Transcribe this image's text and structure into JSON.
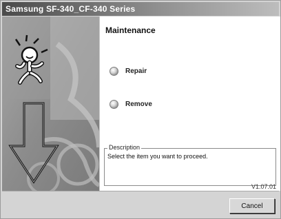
{
  "window": {
    "title": "Samsung SF-340_CF-340 Series"
  },
  "main": {
    "heading": "Maintenance",
    "options": [
      {
        "label": "Repair"
      },
      {
        "label": "Remove"
      }
    ],
    "description": {
      "legend": "Description",
      "text": "Select the item you want to proceed."
    },
    "version": "V1.07.01"
  },
  "footer": {
    "cancel_label": "Cancel"
  }
}
